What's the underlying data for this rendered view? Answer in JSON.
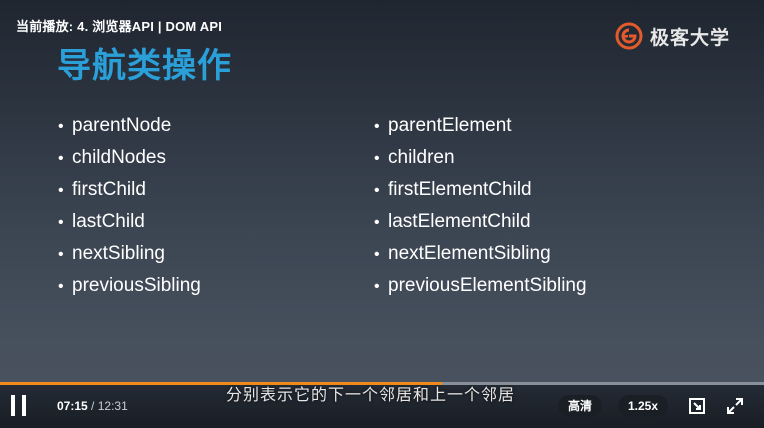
{
  "player": {
    "now_playing": "当前播放: 4. 浏览器API | DOM API"
  },
  "logo": {
    "text": "极客大学",
    "brand_color": "#e35a2b"
  },
  "slide": {
    "title": "导航类操作",
    "title_color": "#2a9fd8",
    "left_items": [
      "parentNode",
      "childNodes",
      "firstChild",
      "lastChild",
      "nextSibling",
      "previousSibling"
    ],
    "right_items": [
      "parentElement",
      "children",
      "firstElementChild",
      "lastElementChild",
      "nextElementSibling",
      "previousElementSibling"
    ],
    "bullet": "•"
  },
  "subtitle": "分别表示它的下一个邻居和上一个邻居",
  "controls": {
    "current_time": "07:15",
    "separator": "/",
    "total_time": "12:31",
    "progress_fraction": 0.579,
    "progress_color": "#f08a1c",
    "quality_label": "高清",
    "speed_label": "1.25x",
    "icons": {
      "play_pause": "pause-icon",
      "pip": "picture-in-picture-icon",
      "fullscreen": "fullscreen-icon"
    }
  }
}
